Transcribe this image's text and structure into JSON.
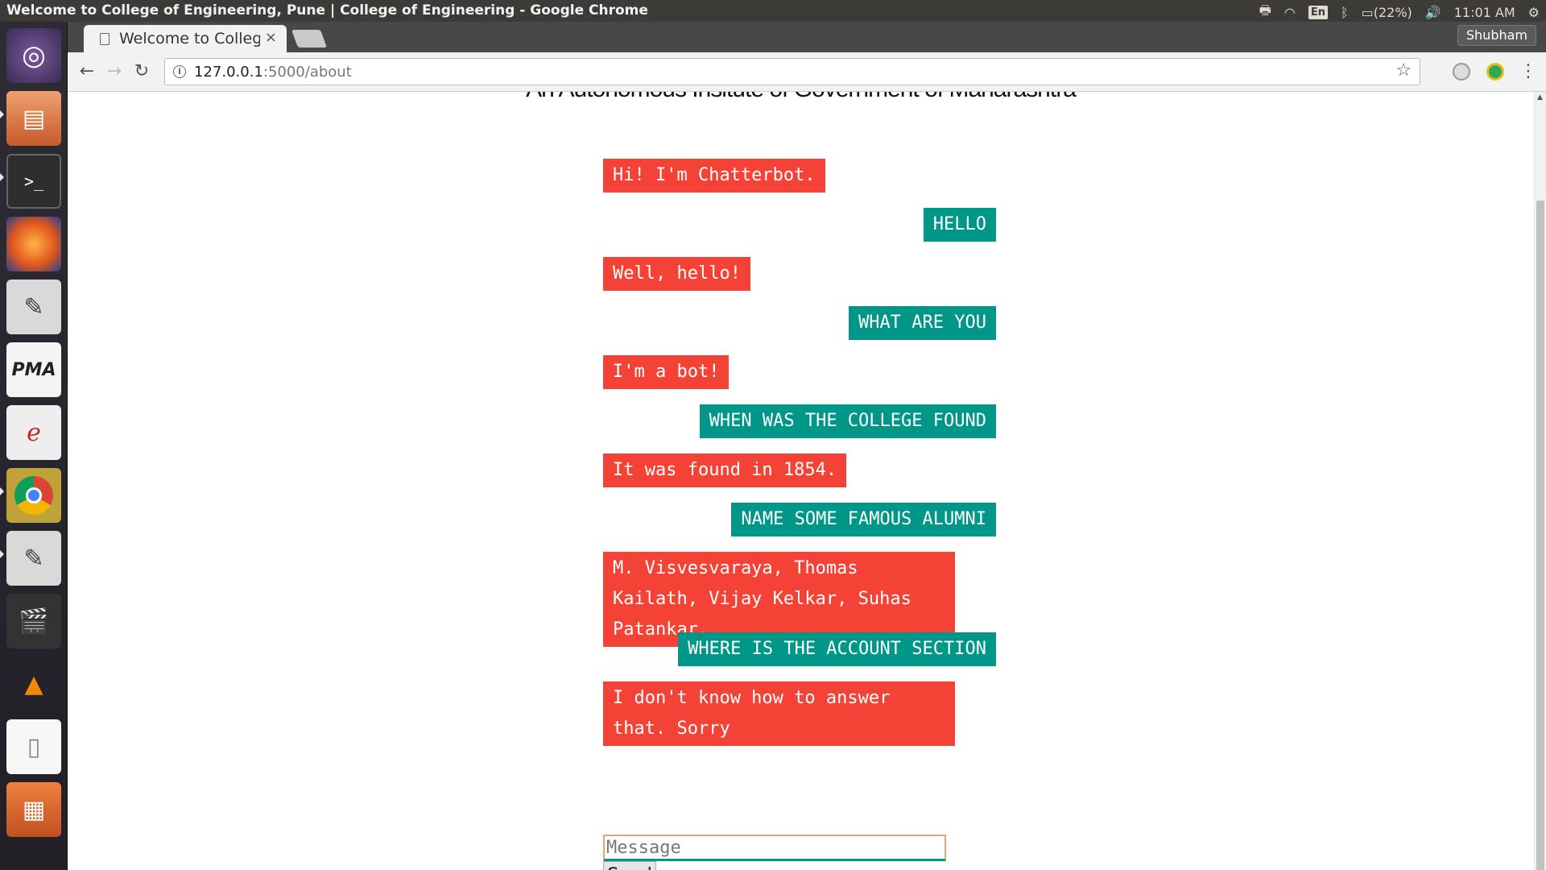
{
  "system": {
    "window_title": "Welcome to College of Engineering, Pune | College of Engineering - Google Chrome",
    "language": "En",
    "battery": "(22%)",
    "clock": "11:01 AM"
  },
  "launcher": {
    "apps": [
      "ubuntu-dash",
      "files",
      "terminal",
      "firefox",
      "text-editor",
      "phpmyadmin",
      "document-viewer",
      "chrome",
      "text-editor-2",
      "video-editor",
      "vlc",
      "libreoffice",
      "archive-manager"
    ]
  },
  "browser": {
    "tab_title": "Welcome to College of Engineering, Pune | College of Engineering",
    "tab_close": "×",
    "profile": "Shubham",
    "url_host": "127.0.0.1",
    "url_path": ":5000/about",
    "back": "←",
    "forward": "→",
    "reload": "↻",
    "bookmark_star": "☆"
  },
  "page": {
    "subtitle": "An Autonomous Insitute of Government of Maharashtra",
    "messages": [
      {
        "from": "bot",
        "text": "Hi! I'm Chatterbot."
      },
      {
        "from": "user",
        "text": "HELLO"
      },
      {
        "from": "bot",
        "text": "Well, hello!"
      },
      {
        "from": "user",
        "text": "WHAT ARE YOU"
      },
      {
        "from": "bot",
        "text": "I'm a bot!"
      },
      {
        "from": "user",
        "text": "WHEN WAS THE COLLEGE FOUND"
      },
      {
        "from": "bot",
        "text": "It was found in 1854."
      },
      {
        "from": "user",
        "text": "NAME SOME FAMOUS ALUMNI"
      },
      {
        "from": "bot",
        "text": "M. Visvesvaraya, Thomas Kailath, Vijay Kelkar, Suhas Patankar."
      },
      {
        "from": "user",
        "text": "WHERE IS THE ACCOUNT SECTION"
      },
      {
        "from": "bot",
        "text": "I don't know how to answer that. Sorry"
      }
    ],
    "input_placeholder": "Message",
    "send_label": "Send"
  },
  "colors": {
    "bot_bubble": "#f44336",
    "user_bubble": "#009688",
    "panel": "#3c3b37"
  }
}
